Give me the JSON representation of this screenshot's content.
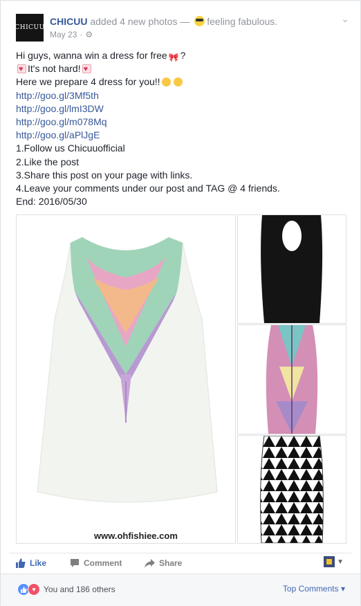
{
  "post": {
    "author": "CHICUU",
    "avatar_text": "CHICUU",
    "action": "added 4 new photos —",
    "feeling": "feeling fabulous.",
    "date": "May 23",
    "separator": "·",
    "privacy_icon": "gear-icon",
    "menu_icon": "chevron-down-icon"
  },
  "content": {
    "line1_start": "Hi guys, wanna win a dress for free",
    "line1_end": "?",
    "line2": "It's not hard!",
    "line3": "Here we prepare 4 dress for you!!",
    "links": [
      "http://goo.gl/3Mf5th",
      "http://goo.gl/lmI3DW",
      "http://goo.gl/m078Mq",
      "http://goo.gl/aPlJgE"
    ],
    "steps": [
      "1.Follow us Chicuuofficial",
      "2.Like the post",
      "3.Share this post on your page with links.",
      "4.Leave your comments under our post and TAG @ 4 friends."
    ],
    "end": "End: 2016/05/30"
  },
  "photos": {
    "watermark": "www.ohfishiee.com"
  },
  "actions": {
    "like": "Like",
    "comment": "Comment",
    "share": "Share"
  },
  "footer": {
    "reactions_text": "You and 186 others",
    "top_comments": "Top Comments"
  },
  "colors": {
    "link": "#365899",
    "like_blue": "#4267b2",
    "love_red": "#f25268"
  }
}
